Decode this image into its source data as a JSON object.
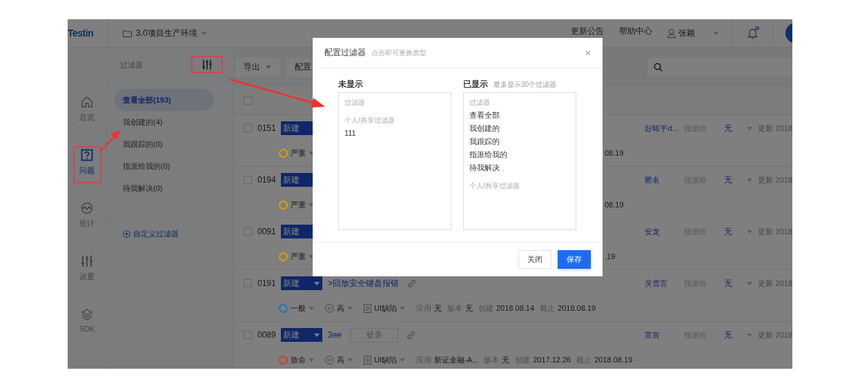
{
  "topbar": {
    "logo": "Testin",
    "project": "3.0项目生产环境",
    "links": [
      "更新公告",
      "帮助中心"
    ],
    "user": "张颖",
    "notification_dot": true
  },
  "nav": [
    {
      "label": "总览",
      "selected": false
    },
    {
      "label": "问题",
      "selected": true
    },
    {
      "label": "统计",
      "selected": false
    },
    {
      "label": "设置",
      "selected": false
    },
    {
      "label": "SDK",
      "selected": false
    }
  ],
  "filter_panel": {
    "title": "过滤器",
    "items": [
      {
        "label": "查看全部(193)",
        "selected": true
      },
      {
        "label": "我创建的(4)",
        "selected": false
      },
      {
        "label": "我跟踪的(0)",
        "selected": false
      },
      {
        "label": "指派给我的(0)",
        "selected": false
      },
      {
        "label": "待我解决(0)",
        "selected": false
      }
    ],
    "custom_link": "自定义过滤器"
  },
  "toolbar": {
    "buttons": [
      {
        "label": "导出",
        "dropdown": true
      },
      {
        "label": "配置",
        "dropdown": false
      }
    ]
  },
  "select_all": {
    "checked": false
  },
  "rows": [
    {
      "id": "0151",
      "checked": false,
      "status": "新建",
      "assignee": "彭铭宇d...",
      "assign_label": "指派给",
      "assign_target": "无",
      "updated": "更新 2018",
      "severity": {
        "label": "严重",
        "color": "#d9a000"
      },
      "tail": "08.19"
    },
    {
      "id": "0194",
      "checked": false,
      "status": "新建",
      "assignee": "匿名",
      "assign_label": "指派给",
      "assign_target": "无",
      "updated": "更新 2018",
      "severity": {
        "label": "严重",
        "color": "#d9a000"
      },
      "tail": "08.19"
    },
    {
      "id": "0091",
      "checked": false,
      "status": "新建",
      "assignee": "安龙",
      "assign_label": "指派给",
      "assign_target": "无",
      "updated": "更新 2018",
      "severity": {
        "label": "严重",
        "color": "#d9a000"
      },
      "tail": ".19"
    },
    {
      "id": "0191",
      "checked": false,
      "status": "新建",
      "title": ">回放安全键盘报错",
      "assignee": "吴雪言",
      "assign_label": "指派给",
      "assign_target": "无",
      "updated": "更新 2018",
      "severity": {
        "label": "一般",
        "color": "#1c6fd0"
      },
      "priority": "高",
      "type": "UI缺陷",
      "meta": [
        {
          "label": "应用",
          "value": "无"
        },
        {
          "label": "版本",
          "value": "无"
        },
        {
          "label": "创建",
          "value": "2018.08.14"
        },
        {
          "label": "截止",
          "value": "2018.08.19"
        }
      ]
    },
    {
      "id": "0089",
      "checked": false,
      "status": "新建",
      "title": "3ee",
      "tag": "登录",
      "assignee": "宣宸",
      "assign_label": "指派给",
      "assign_target": "无",
      "updated": "更新 2018",
      "severity": {
        "label": "致命",
        "color": "#d03a2a"
      },
      "priority": "高",
      "type": "UI缺陷",
      "meta": [
        {
          "label": "应用",
          "value": "新证金融-A..."
        },
        {
          "label": "版本",
          "value": "无"
        },
        {
          "label": "创建",
          "value": "2017.12.26"
        },
        {
          "label": "截止",
          "value": "2018.08.19"
        }
      ]
    }
  ],
  "modal": {
    "title": "配置过滤器",
    "hint": "点击即可更换类型",
    "columns": [
      {
        "heading": "未显示",
        "sections": [
          {
            "title": "过滤器"
          },
          {
            "title": "个人/共享过滤器",
            "items": [
              "111"
            ]
          }
        ]
      },
      {
        "heading": "已显示",
        "note": "最多显示30个过滤器",
        "sections": [
          {
            "title": "过滤器",
            "items": [
              "查看全部",
              "我创建的",
              "我跟踪的",
              "指派给我的",
              "待我解决"
            ]
          },
          {
            "title": "个人/共享过滤器"
          }
        ]
      }
    ],
    "buttons": [
      {
        "label": "关闭",
        "kind": "secondary"
      },
      {
        "label": "保存",
        "kind": "primary"
      }
    ]
  }
}
